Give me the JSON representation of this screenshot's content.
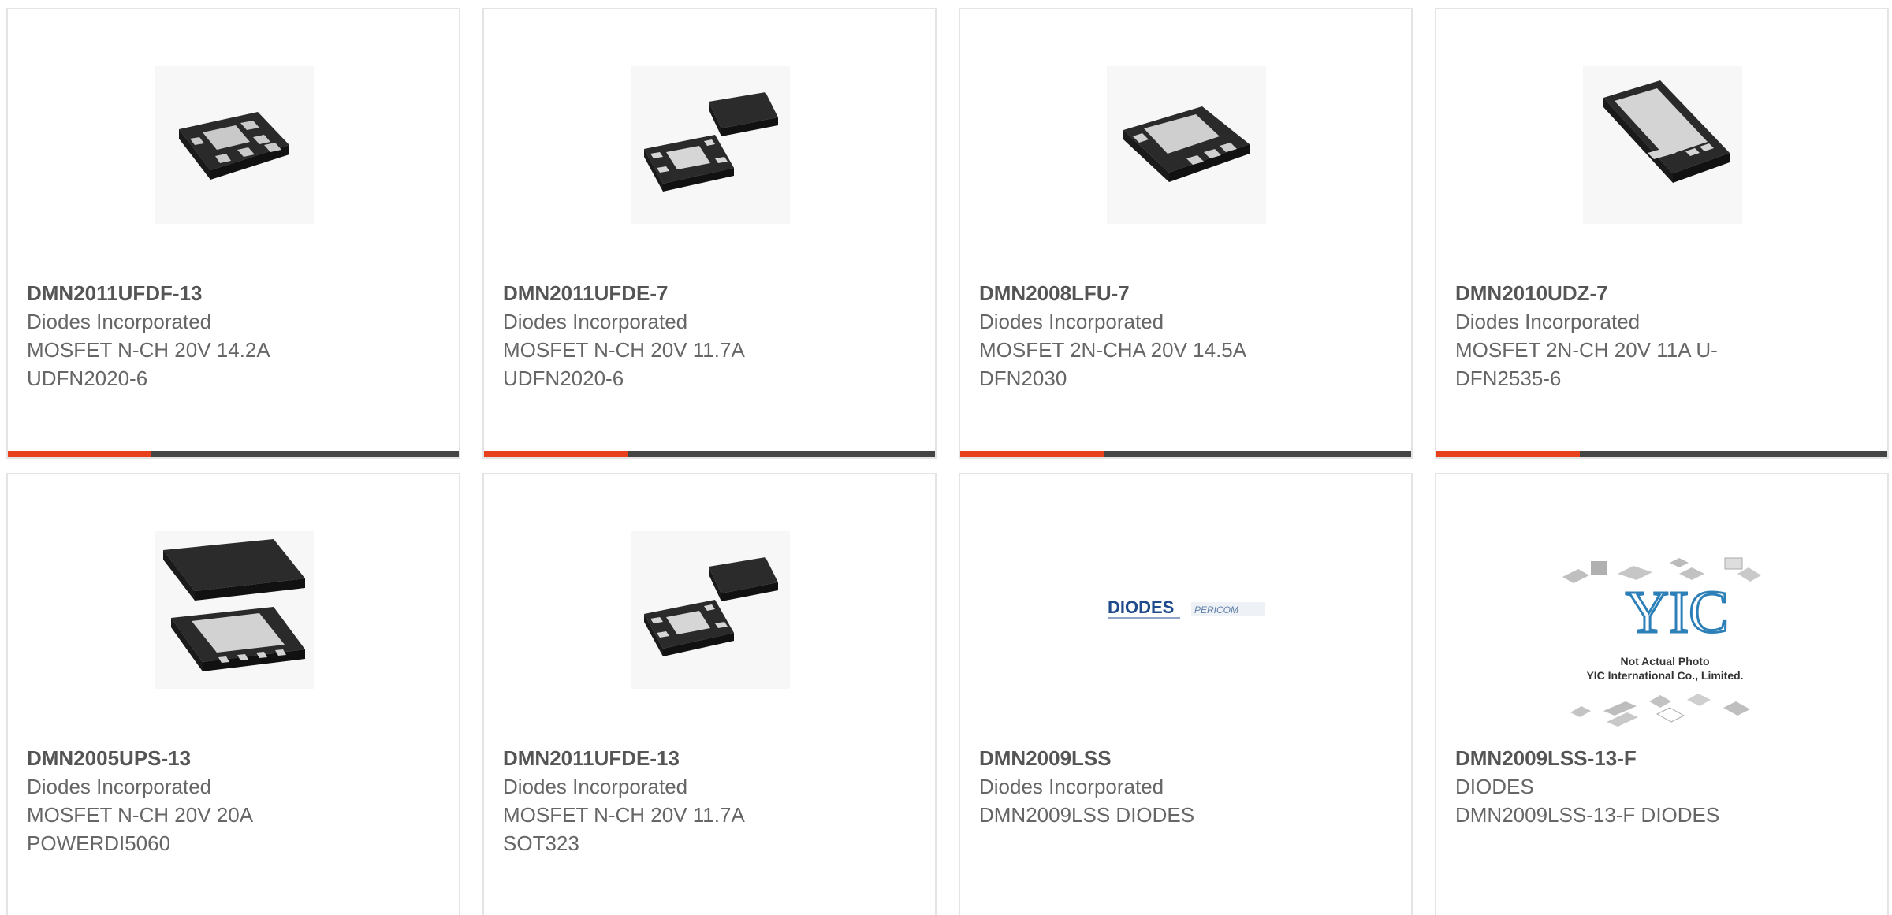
{
  "colors": {
    "accent": "#e8401c",
    "bar": "#444444",
    "border": "#e4e4e4",
    "text": "#666666",
    "part_text": "#555555"
  },
  "products": [
    {
      "part": "DMN2011UFDF-13",
      "manufacturer": "Diodes Incorporated",
      "description": "MOSFET N-CH 20V 14.2A\nUDFN2020-6",
      "image": "udfn2020-6-package-icon"
    },
    {
      "part": "DMN2011UFDE-7",
      "manufacturer": "Diodes Incorporated",
      "description": "MOSFET N-CH 20V 11.7A\nUDFN2020-6",
      "image": "udfn2020-6-package-pair-icon"
    },
    {
      "part": "DMN2008LFU-7",
      "manufacturer": "Diodes Incorporated",
      "description": "MOSFET 2N-CHA 20V 14.5A\nDFN2030",
      "image": "dfn2030-package-icon"
    },
    {
      "part": "DMN2010UDZ-7",
      "manufacturer": "Diodes Incorporated",
      "description": "MOSFET 2N-CH 20V 11A U-\nDFN2535-6",
      "image": "u-dfn2535-package-icon"
    },
    {
      "part": "DMN2005UPS-13",
      "manufacturer": "Diodes Incorporated",
      "description": "MOSFET N-CH 20V 20A\nPOWERDI5060",
      "image": "powerdi5060-package-icon"
    },
    {
      "part": "DMN2011UFDE-13",
      "manufacturer": "Diodes Incorporated",
      "description": "MOSFET N-CH 20V 11.7A\nSOT323",
      "image": "sot323-package-pair-icon"
    },
    {
      "part": "DMN2009LSS",
      "manufacturer": "Diodes Incorporated",
      "description": "DMN2009LSS DIODES",
      "image": "diodes-pericom-logo",
      "logo_text": "DIODES",
      "logo_sub": "PERICOM"
    },
    {
      "part": "DMN2009LSS-13-F",
      "manufacturer": "DIODES",
      "description": "DMN2009LSS-13-F DIODES",
      "image": "not-actual-photo-placeholder",
      "logo_text": "YIC",
      "notice_line1": "Not Actual Photo",
      "notice_line2": "YIC International Co., Limited."
    }
  ]
}
